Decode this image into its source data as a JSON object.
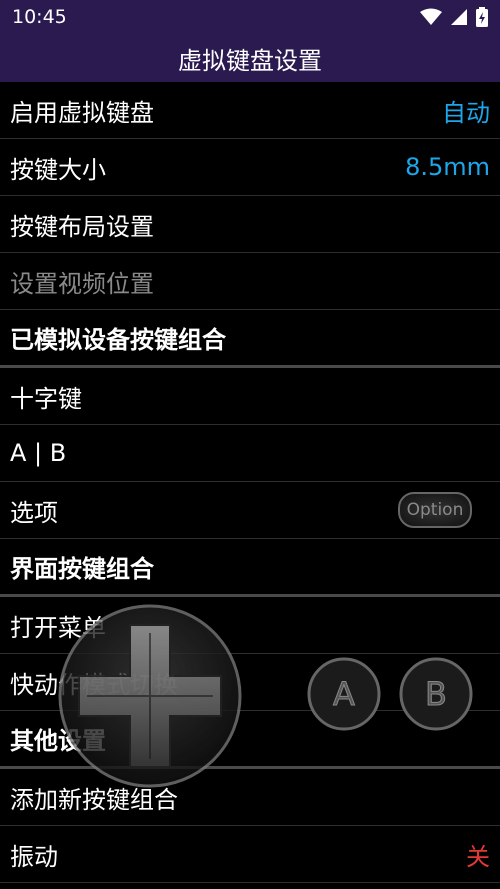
{
  "status_bar": {
    "time": "10:45"
  },
  "header": {
    "title": "虚拟键盘设置"
  },
  "rows": {
    "enable_vkb": {
      "label": "启用虚拟键盘",
      "value": "自动"
    },
    "key_size": {
      "label": "按键大小",
      "value": "8.5mm"
    },
    "layout": {
      "label": "按键布局设置"
    },
    "video_pos": {
      "label": "设置视频位置"
    },
    "section_emulated": {
      "label": "已模拟设备按键组合"
    },
    "dpad": {
      "label": "十字键"
    },
    "ab": {
      "label": "A | B"
    },
    "option": {
      "label": "选项",
      "button": "Option"
    },
    "section_ui": {
      "label": "界面按键组合"
    },
    "open_menu": {
      "label": "打开菜单"
    },
    "quick_action": {
      "label": "快动作模式切换"
    },
    "section_other": {
      "label": "其他设置"
    },
    "add_combo": {
      "label": "添加新按键组合"
    },
    "vibrate": {
      "label": "振动",
      "value": "关"
    }
  },
  "overlay": {
    "a_label": "A",
    "b_label": "B"
  },
  "colors": {
    "accent_blue": "#1ea6ea",
    "off_red": "#e53935",
    "bar_purple": "#2a1a50"
  }
}
